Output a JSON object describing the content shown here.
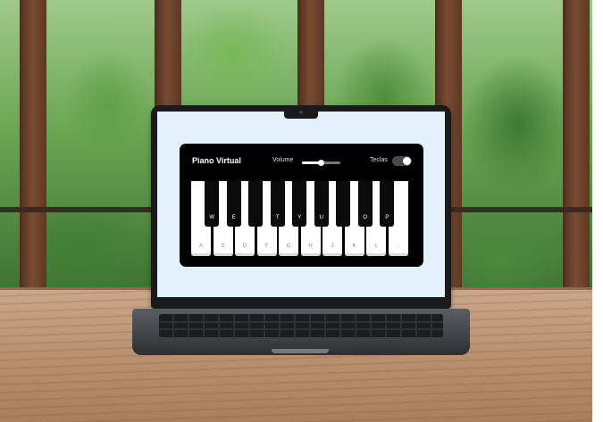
{
  "app": {
    "title": "Piano Virtual",
    "volume_label": "Volume",
    "volume_level": 0.5,
    "keys_label": "Teclas",
    "keys_toggle_on": true
  },
  "piano": {
    "white_keys": [
      "A",
      "S",
      "D",
      "F",
      "G",
      "H",
      "J",
      "K",
      "L",
      ";"
    ],
    "black_keys": [
      "W",
      "E",
      "",
      "T",
      "Y",
      "U",
      "",
      "O",
      "P"
    ]
  },
  "colors": {
    "app_background": "#000000",
    "screen_background": "#e3f1fa",
    "key_white": "#ffffff",
    "key_black": "#0b0b0b"
  }
}
